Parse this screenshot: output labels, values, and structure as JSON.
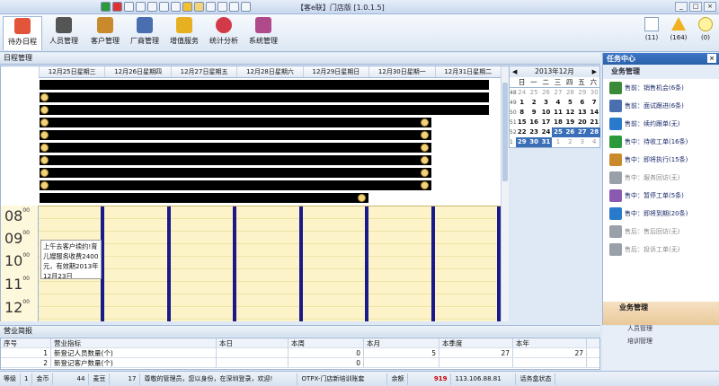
{
  "app": {
    "title": "【客e联】门店版 [1.0.1.5]"
  },
  "toolbar": {
    "items": [
      {
        "label": "待办日程",
        "icon": "calendar-icon",
        "color": "#e2553a"
      },
      {
        "label": "人员管理",
        "icon": "person-icon",
        "color": "#555555"
      },
      {
        "label": "客户管理",
        "icon": "customers-icon",
        "color": "#c98a2e"
      },
      {
        "label": "厂商管理",
        "icon": "vendors-icon",
        "color": "#4a6fb0"
      },
      {
        "label": "增值服务",
        "icon": "money-icon",
        "color": "#e6b020"
      },
      {
        "label": "统计分析",
        "icon": "pie-chart-icon",
        "color": "#d23a4a"
      },
      {
        "label": "系统管理",
        "icon": "system-icon",
        "color": "#b04a8a"
      }
    ],
    "stats": [
      {
        "value": "(11)",
        "icon": "list-icon"
      },
      {
        "value": "(164)",
        "icon": "warning-icon"
      },
      {
        "value": "(0)",
        "icon": "lightbulb-icon"
      }
    ]
  },
  "schedule": {
    "section_title": "日程管理",
    "days": [
      "12月25日星期三",
      "12月26日星期四",
      "12月27日星期五",
      "12月28日星期六",
      "12月29日星期日",
      "12月30日星期一",
      "12月31日星期二"
    ],
    "hours": [
      "08",
      "09",
      "10",
      "11",
      "12"
    ],
    "hour_suffix": "00",
    "appointment": "上午去客户续约!育儿嫂服务收费2400元，有效期2013年12月23日"
  },
  "calendar": {
    "month": "2013年12月",
    "weekdays": [
      "日",
      "一",
      "二",
      "三",
      "四",
      "五",
      "六"
    ],
    "weeks": [
      {
        "wk": "48",
        "days": [
          "24",
          "25",
          "26",
          "27",
          "28",
          "29",
          "30"
        ]
      },
      {
        "wk": "49",
        "days": [
          "1",
          "2",
          "3",
          "4",
          "5",
          "6",
          "7"
        ]
      },
      {
        "wk": "50",
        "days": [
          "8",
          "9",
          "10",
          "11",
          "12",
          "13",
          "14"
        ]
      },
      {
        "wk": "51",
        "days": [
          "15",
          "16",
          "17",
          "18",
          "19",
          "20",
          "21"
        ]
      },
      {
        "wk": "52",
        "days": [
          "22",
          "23",
          "24",
          "25",
          "26",
          "27",
          "28"
        ]
      },
      {
        "wk": "1",
        "days": [
          "29",
          "30",
          "31",
          "1",
          "2",
          "3",
          "4"
        ]
      }
    ]
  },
  "task_center": {
    "title": "任务中心",
    "section": "业务管理",
    "items": [
      {
        "label": "售前：销售机会(6条)",
        "icon": "opportunity-icon",
        "enabled": true
      },
      {
        "label": "售前：面试跟进(6条)",
        "icon": "interview-icon",
        "enabled": true
      },
      {
        "label": "售前：续约跟单(无)",
        "icon": "renew-icon",
        "enabled": true
      },
      {
        "label": "售中：待收工单(16条)",
        "icon": "pending-order-icon",
        "enabled": true
      },
      {
        "label": "售中：即将执行(15条)",
        "icon": "upcoming-icon",
        "enabled": true
      },
      {
        "label": "售中：服务回访(无)",
        "icon": "revisit-icon",
        "enabled": false
      },
      {
        "label": "售中：暂停工单(5条)",
        "icon": "pause-icon",
        "enabled": true
      },
      {
        "label": "售中：即将到期(20条)",
        "icon": "expiring-icon",
        "enabled": true
      },
      {
        "label": "售后：售后回访(无)",
        "icon": "aftersale-icon",
        "enabled": false
      },
      {
        "label": "售后：投诉工单(无)",
        "icon": "complaint-icon",
        "enabled": false
      }
    ],
    "footer": "业务管理"
  },
  "right_bottom": {
    "items": [
      "人员管理",
      "培训管理"
    ]
  },
  "business_report": {
    "title": "营业简报",
    "columns": [
      "序号",
      "营业指标",
      "本日",
      "本周",
      "本月",
      "本季度",
      "本年"
    ],
    "rows": [
      [
        "1",
        "新登记人员数量(个)",
        "",
        "0",
        "5",
        "27",
        "27"
      ],
      [
        "2",
        "新登记客户数量(个)",
        "",
        "0",
        "",
        "",
        ""
      ]
    ]
  },
  "statusbar": {
    "level_label": "等级",
    "level": "1",
    "coin_label": "金币",
    "coin": "44",
    "bean_label": "麦豆",
    "bean": "17",
    "message": "尊敬的管理员，您以身份，在深圳登录，欢迎!",
    "store": "OTPX-门店新培训账套",
    "balance_label": "余额",
    "balance": "919",
    "ip": "113.106.88.81",
    "server": "话务盒状态"
  }
}
